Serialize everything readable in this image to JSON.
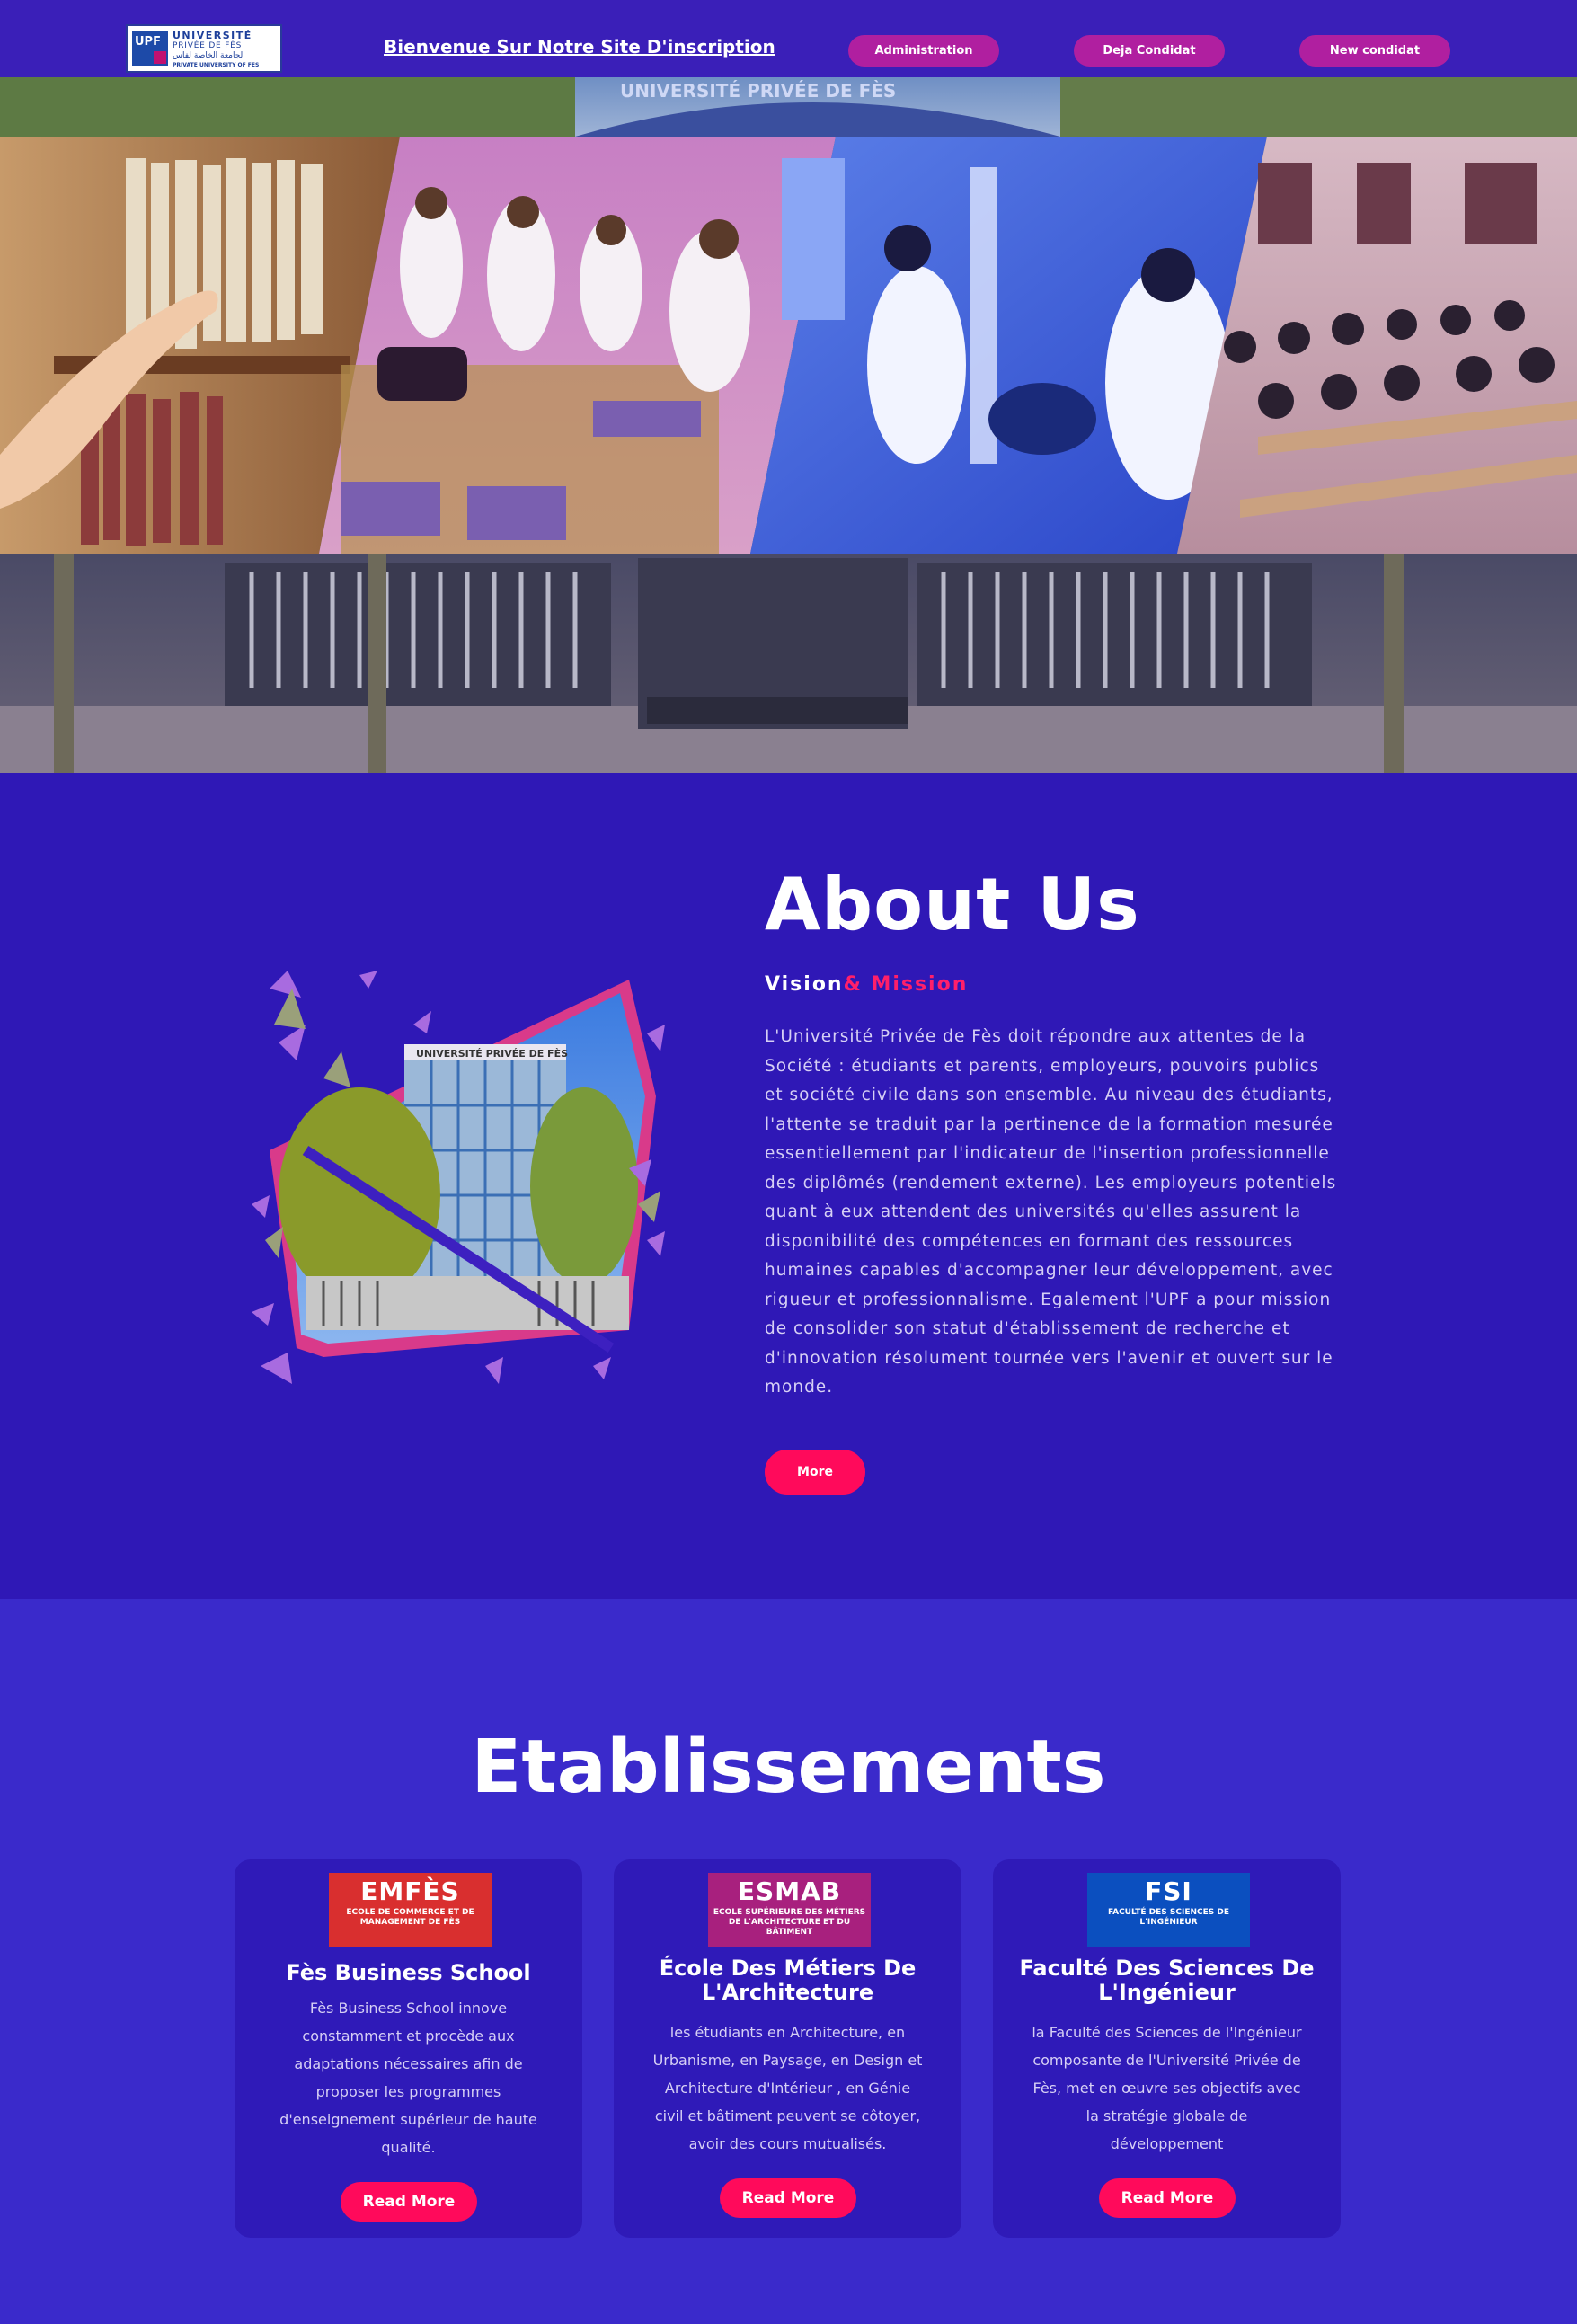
{
  "header": {
    "logo": {
      "mark": "UPF",
      "line1": "UNIVERSITÉ",
      "line2": "PRIVÉE DE FÈS",
      "line3": "الجامعة الخاصة لفاس",
      "line4": "PRIVATE UNIVERSITY OF FES"
    },
    "welcome": "Bienvenue Sur Notre Site D'inscription",
    "nav": [
      {
        "label": "Administration"
      },
      {
        "label": "Deja Condidat"
      },
      {
        "label": "New condidat"
      }
    ]
  },
  "hero": {
    "building_sign": "UNIVERSITÉ PRIVÉE DE FÈS"
  },
  "about": {
    "title": "About Us",
    "sub_vision": "Vision",
    "sub_mission": "& Mission",
    "image_sign": "UNIVERSITÉ PRIVÉE DE FÈS",
    "text": "L'Université Privée de Fès doit répondre aux attentes de la Société : étudiants et parents, employeurs, pouvoirs publics et société civile dans son ensemble. Au niveau des étudiants, l'attente se traduit par la pertinence de la formation mesurée essentiellement par l'indicateur de l'insertion professionnelle des diplômés (rendement externe). Les employeurs potentiels quant à eux attendent des universités qu'elles assurent la disponibilité des compétences en formant des ressources humaines capables d'accompagner leur développement, avec rigueur et professionnalisme. Egalement l'UPF a pour mission de consolider son statut d'établissement de recherche et d'innovation résolument tournée vers l'avenir et ouvert sur le monde.",
    "more_label": "More"
  },
  "etablissements": {
    "title": "Etablissements",
    "cards": [
      {
        "logo_big": "EMFÈS",
        "logo_small": "ECOLE DE COMMERCE ET DE MANAGEMENT DE FÈS",
        "logo_color": "#d92f2f",
        "title": "Fès Business School",
        "text": "Fès Business School innove constamment et procède aux adaptations nécessaires afin de proposer les programmes d'enseignement supérieur de haute qualité.",
        "button": "Read More"
      },
      {
        "logo_big": "ESMAB",
        "logo_small": "ECOLE SUPÉRIEURE DES MÉTIERS DE L'ARCHITECTURE ET DU BÂTIMENT",
        "logo_color": "#a8207e",
        "title": "École Des Métiers De L'Architecture",
        "text": "les étudiants en Architecture, en Urbanisme, en Paysage, en Design et Architecture d'Intérieur , en Génie civil et bâtiment peuvent se côtoyer, avoir des cours mutualisés.",
        "button": "Read More"
      },
      {
        "logo_big": "FSI",
        "logo_small": "FACULTÉ DES SCIENCES DE L'INGÉNIEUR",
        "logo_color": "#0b4fbf",
        "title": "Faculté Des Sciences De L'Ingénieur",
        "text": "la Faculté des Sciences de l'Ingénieur composante de l'Université Privée de Fès, met en œuvre ses objectifs avec la stratégie globale de développement",
        "button": "Read More"
      }
    ]
  },
  "colors": {
    "header_bg": "#3a1fb8",
    "about_bg": "#2f18b6",
    "etab_bg": "#3a2acb",
    "card_bg": "#2f1ab8",
    "accent_pink": "#ff0a5b",
    "nav_pill": "#b01fa0"
  }
}
